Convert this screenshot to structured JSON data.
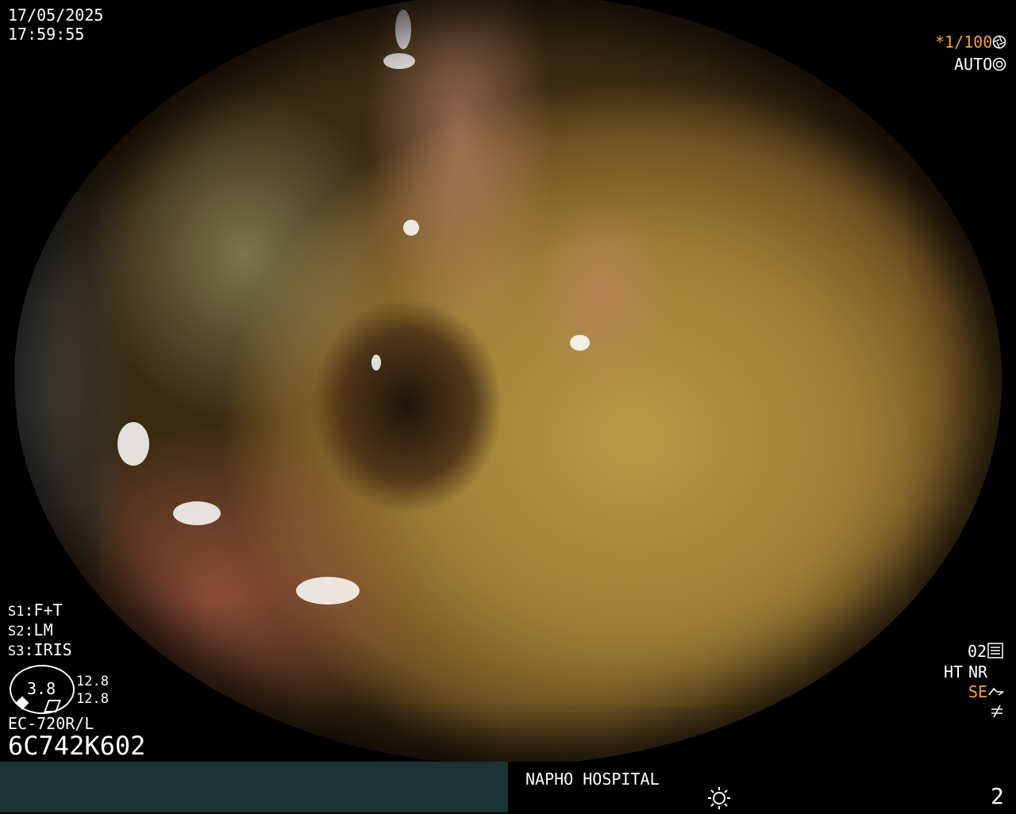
{
  "date": "17/05/2025",
  "time": "17:59:55",
  "shutter": "*1/100",
  "shutter_icon": "aperture-icon",
  "exposure_mode": "AUTO",
  "exposure_icon": "iris-icon",
  "s1": {
    "key": "S1",
    "value": "F+T"
  },
  "s2": {
    "key": "S2",
    "value": "LM"
  },
  "s3": {
    "key": "S3",
    "value": "IRIS"
  },
  "gauge_value": "3.8",
  "gauge_side_top": "12.8",
  "gauge_side_bottom": "12.8",
  "scope_model": "EC-720R/L",
  "serial": "6C742K602",
  "mode_code": "02",
  "ht": "HT",
  "nr": "NR",
  "se": "SE",
  "hospital": "NAPHO HOSPITAL",
  "brightness_icon": "sun-icon",
  "page_number": "2",
  "colors": {
    "accent": "#f5a623",
    "bar": "#1b3333"
  }
}
